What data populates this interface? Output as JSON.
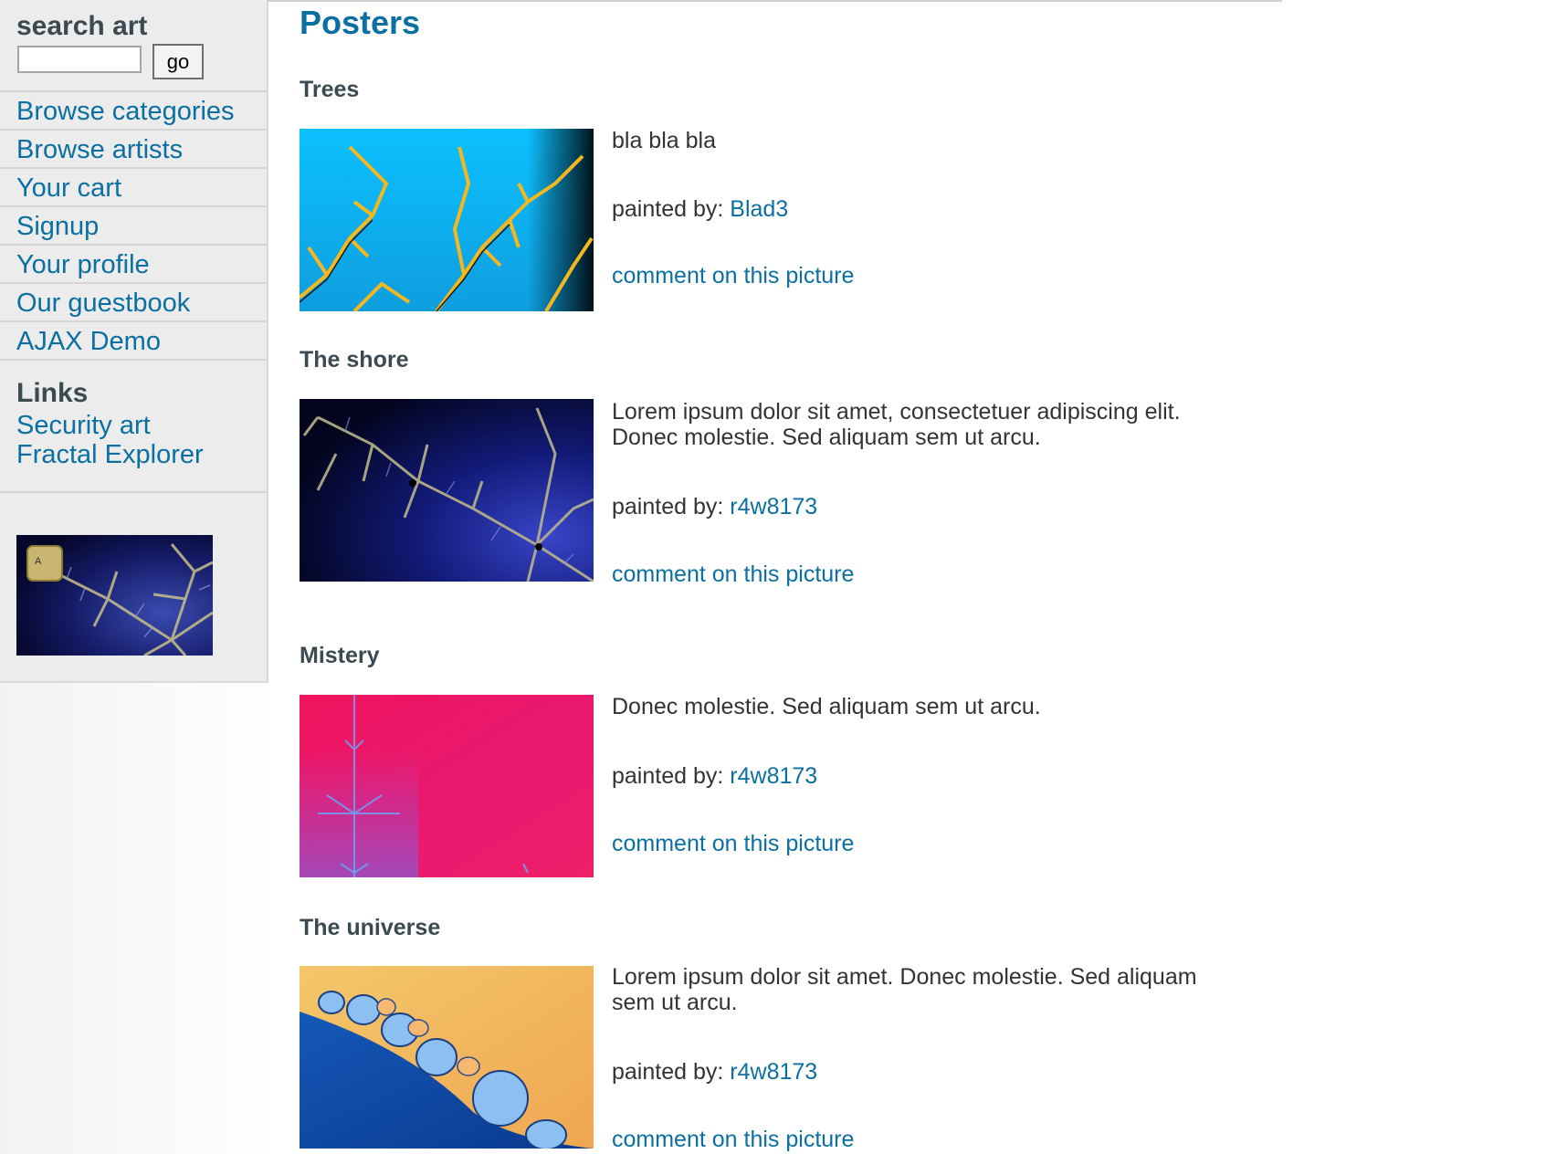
{
  "search": {
    "title": "search art",
    "value": "",
    "button": "go"
  },
  "nav": [
    {
      "label": "Browse categories"
    },
    {
      "label": "Browse artists"
    },
    {
      "label": "Your cart"
    },
    {
      "label": "Signup"
    },
    {
      "label": "Your profile"
    },
    {
      "label": "Our guestbook"
    },
    {
      "label": "AJAX Demo"
    }
  ],
  "links": {
    "title": "Links",
    "items": [
      {
        "label": "Security art"
      },
      {
        "label": "Fractal Explorer"
      }
    ]
  },
  "sidebar_ad": {
    "badge": "A"
  },
  "page_title": "Posters",
  "painted_by_label": "painted by:",
  "comment_label": "comment on this picture",
  "posters": [
    {
      "title": "Trees",
      "description": "bla bla bla",
      "artist": "Blad3"
    },
    {
      "title": "The shore",
      "description": "Lorem ipsum dolor sit amet, consectetuer adipiscing elit. Donec molestie. Sed aliquam sem ut arcu.",
      "artist": "r4w8173"
    },
    {
      "title": "Mistery",
      "description": "Donec molestie. Sed aliquam sem ut arcu.",
      "artist": "r4w8173"
    },
    {
      "title": "The universe",
      "description": "Lorem ipsum dolor sit amet. Donec molestie. Sed aliquam sem ut arcu.",
      "artist": "r4w8173"
    }
  ],
  "colors": {
    "link": "#0b6fa1",
    "heading": "#3a4a50",
    "sidebar_bg": "#ececec"
  }
}
